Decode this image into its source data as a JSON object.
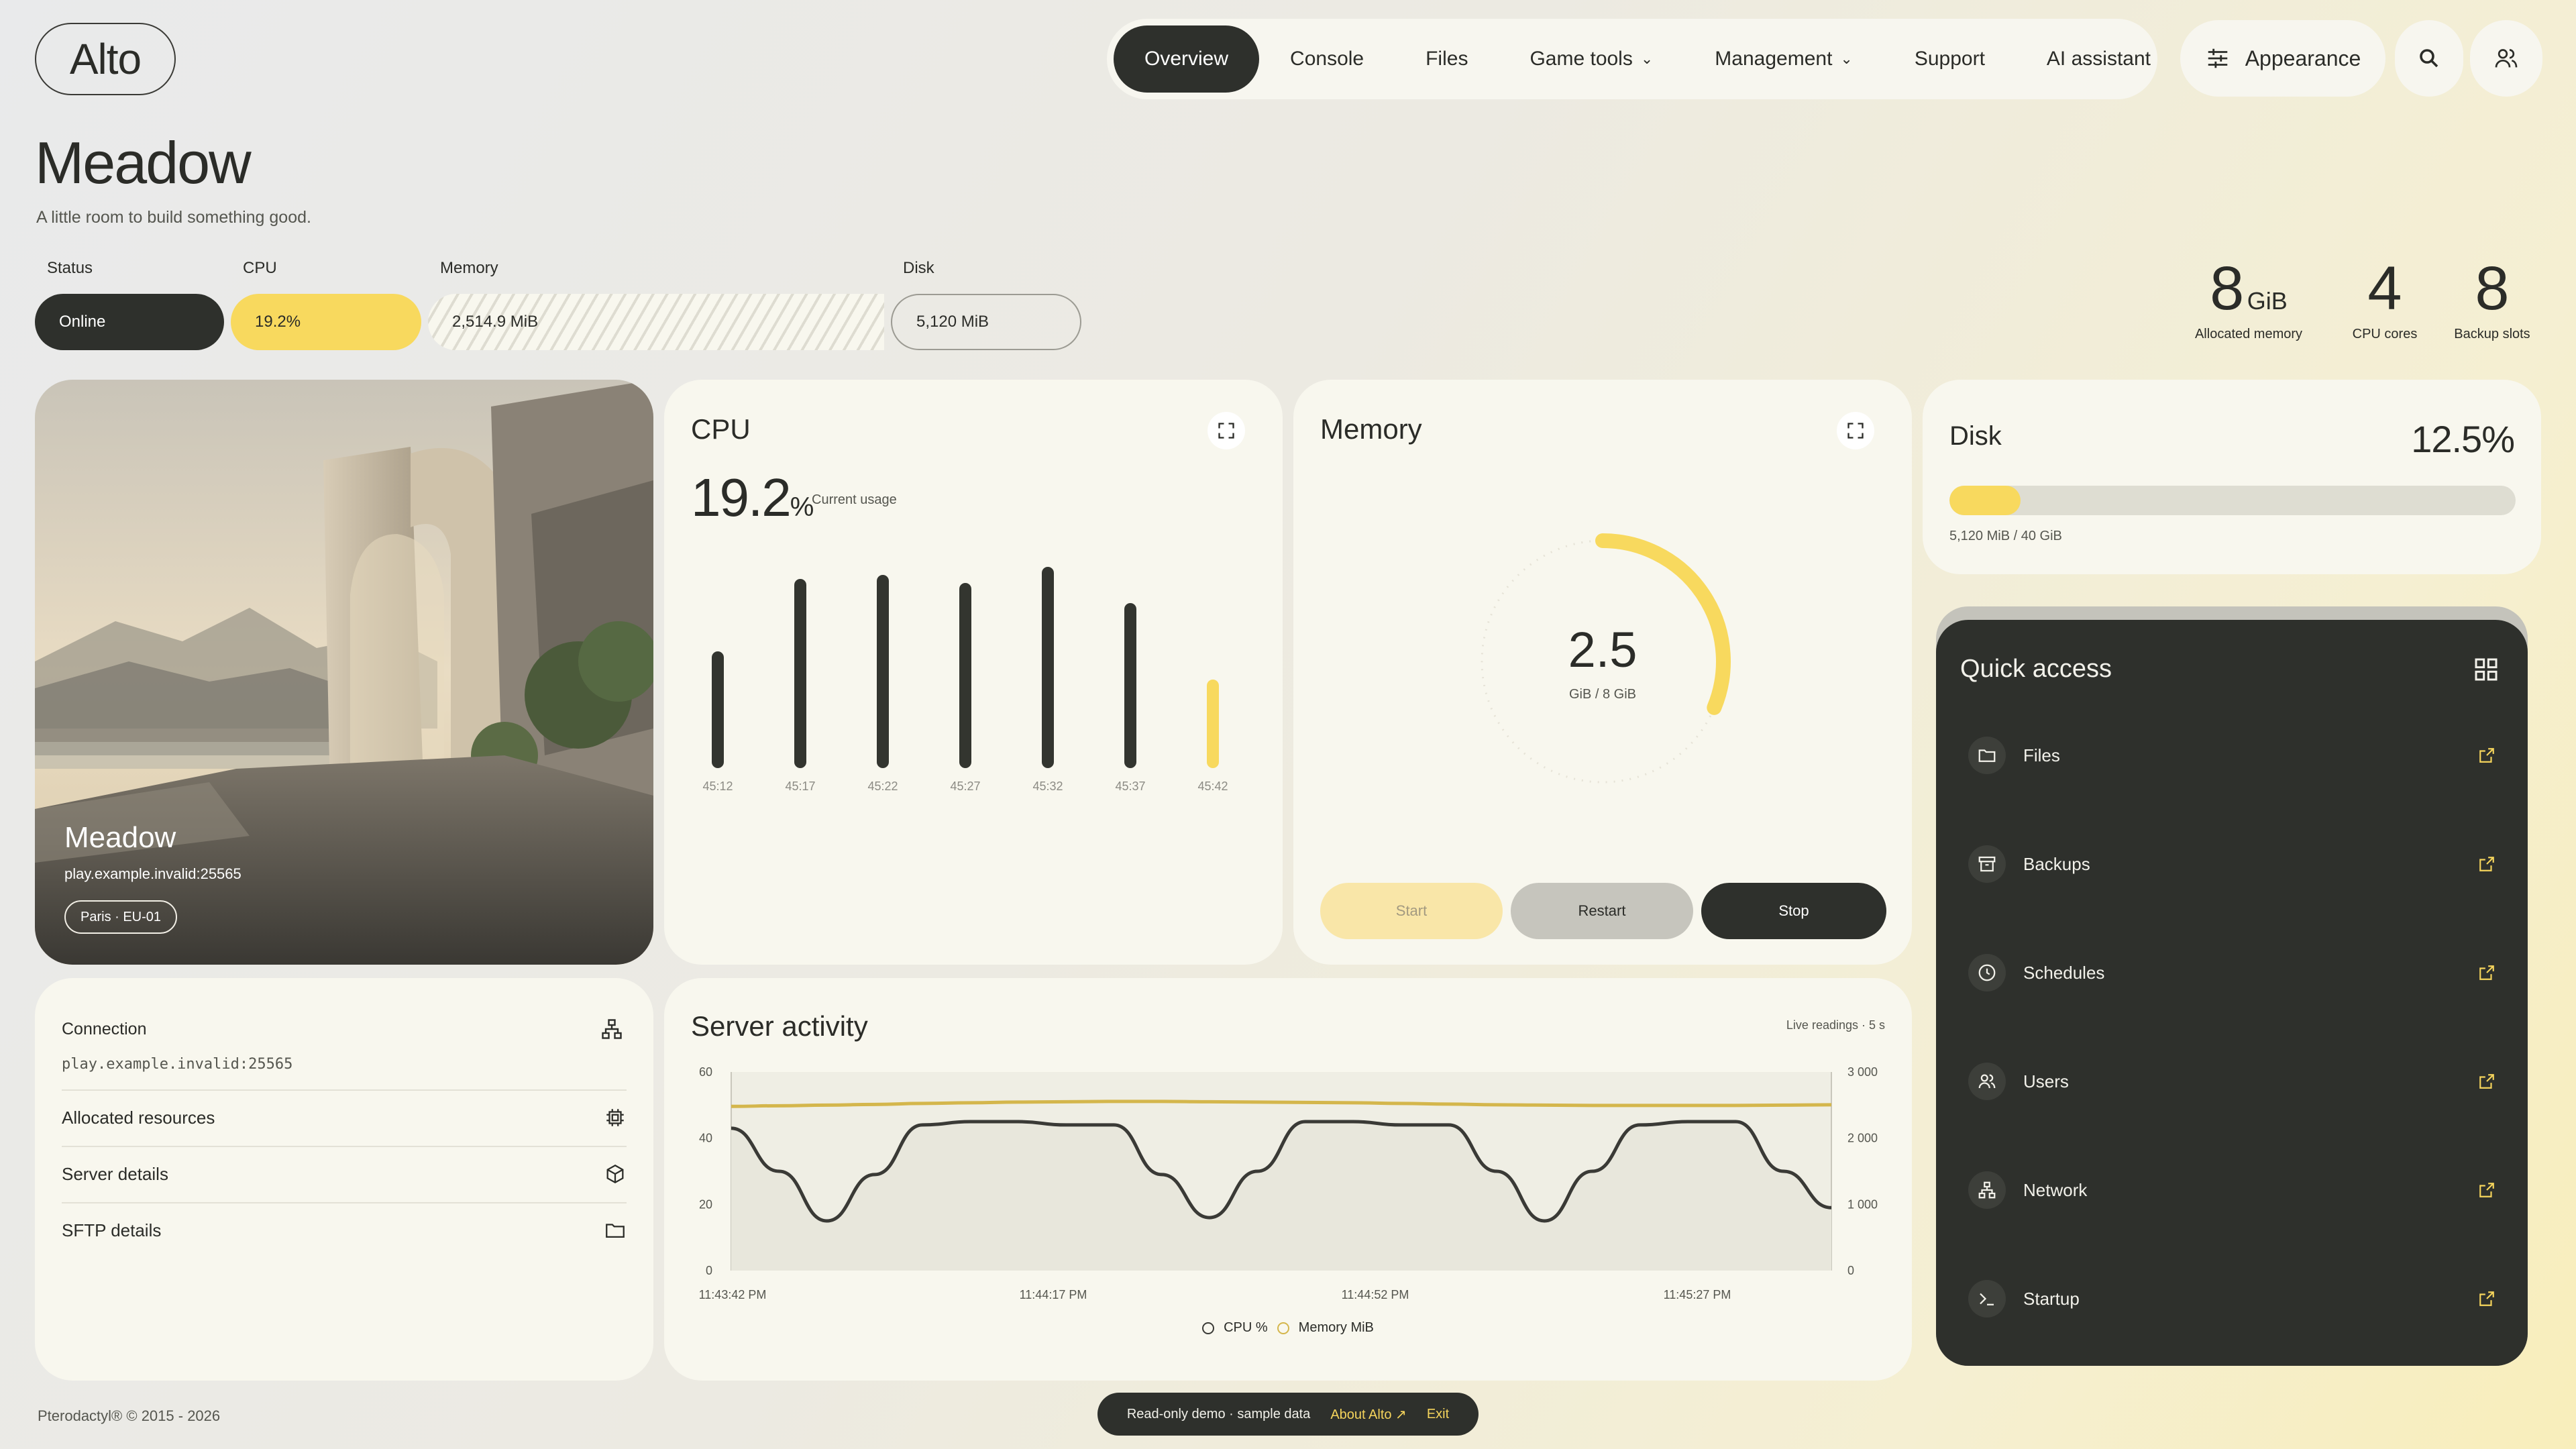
{
  "brand": {
    "logo": "Alto"
  },
  "nav": {
    "items": [
      {
        "label": "Overview",
        "active": true
      },
      {
        "label": "Console"
      },
      {
        "label": "Files"
      },
      {
        "label": "Game tools",
        "dropdown": true
      },
      {
        "label": "Management",
        "dropdown": true
      },
      {
        "label": "Support"
      },
      {
        "label": "AI assistant"
      }
    ],
    "appearance": "Appearance"
  },
  "server": {
    "name": "Meadow",
    "tagline": "A little room to build something good."
  },
  "stats": {
    "status_label": "Status",
    "status_value": "Online",
    "cpu_label": "CPU",
    "cpu_value": "19.2%",
    "memory_label": "Memory",
    "memory_value": "2,514.9 MiB",
    "disk_label": "Disk",
    "disk_value": "5,120 MiB"
  },
  "summary": [
    {
      "value": "8",
      "unit": "GiB",
      "label": "Allocated memory"
    },
    {
      "value": "4",
      "unit": "",
      "label": "CPU cores"
    },
    {
      "value": "8",
      "unit": "",
      "label": "Backup slots"
    }
  ],
  "hero": {
    "name": "Meadow",
    "address": "play.example.invalid:25565",
    "region": "Paris · EU-01"
  },
  "cpu_card": {
    "title": "CPU",
    "value": "19.2",
    "unit": "%",
    "caption": "Current usage"
  },
  "memory_card": {
    "title": "Memory",
    "value": "2.5",
    "caption": "GiB / 8 GiB",
    "fraction": 0.3125,
    "buttons": {
      "start": "Start",
      "restart": "Restart",
      "stop": "Stop"
    }
  },
  "disk_card": {
    "title": "Disk",
    "percent": "12.5%",
    "fraction": 0.125,
    "caption": "5,120 MiB / 40 GiB"
  },
  "quick_access": {
    "title": "Quick access",
    "items": [
      "Files",
      "Backups",
      "Schedules",
      "Users",
      "Network",
      "Startup"
    ]
  },
  "connection": {
    "title": "Connection",
    "address": "play.example.invalid:25565",
    "rows": [
      "Allocated resources",
      "Server details",
      "SFTP details"
    ]
  },
  "activity": {
    "title": "Server activity",
    "note": "Live readings · 5 s",
    "legend_cpu": "CPU %",
    "legend_mem": "Memory MiB"
  },
  "footer": {
    "copyright": "Pterodactyl® © 2015 - 2026",
    "demo": "Read-only demo · sample data",
    "about": "About Alto ↗",
    "exit": "Exit"
  },
  "colors": {
    "accent": "#f8d95e",
    "dark": "#2e302c",
    "card": "#f8f7ee"
  },
  "chart_data": [
    {
      "type": "bar",
      "title": "CPU",
      "categories": [
        "45:12",
        "45:17",
        "45:22",
        "45:27",
        "45:32",
        "45:37",
        "45:42"
      ],
      "values": [
        13,
        22,
        22.5,
        21.5,
        23.5,
        19,
        9.5
      ],
      "highlight_last": true
    },
    {
      "type": "line",
      "title": "Server activity",
      "x_ticks": [
        "11:43:42 PM",
        "11:44:17 PM",
        "11:44:52 PM",
        "11:45:27 PM"
      ],
      "y_left": {
        "ticks": [
          0,
          20,
          40,
          60
        ],
        "ylim": [
          0,
          60
        ]
      },
      "y_right": {
        "ticks": [
          "0",
          "1 000",
          "2 000",
          "3 000"
        ],
        "ylim": [
          0,
          3000
        ]
      },
      "series": [
        {
          "name": "CPU %",
          "axis": "left",
          "values": [
            43,
            30,
            15,
            29,
            44,
            45,
            45,
            44,
            44,
            29,
            16,
            30,
            45,
            45,
            44,
            44,
            30,
            15,
            30,
            44,
            45,
            45,
            30,
            19
          ]
        },
        {
          "name": "Memory MiB",
          "axis": "right",
          "values": [
            2480,
            2490,
            2500,
            2510,
            2525,
            2535,
            2545,
            2550,
            2555,
            2555,
            2550,
            2545,
            2540,
            2535,
            2525,
            2515,
            2505,
            2500,
            2495,
            2495,
            2495,
            2495,
            2500,
            2505
          ]
        }
      ]
    }
  ]
}
